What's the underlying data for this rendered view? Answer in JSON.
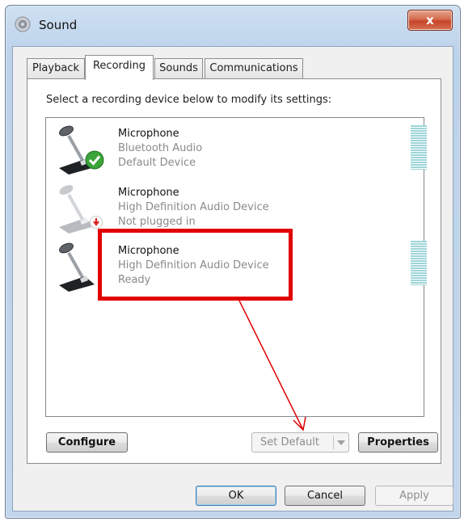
{
  "window": {
    "title": "Sound",
    "title_icon": "speaker-icon",
    "close_label": "x"
  },
  "tabs": [
    {
      "label": "Playback",
      "active": false
    },
    {
      "label": "Recording",
      "active": true
    },
    {
      "label": "Sounds",
      "active": false
    },
    {
      "label": "Communications",
      "active": false
    }
  ],
  "recording": {
    "instruction": "Select a recording device below to modify its settings:",
    "devices": [
      {
        "name": "Microphone",
        "description": "Bluetooth Audio",
        "status": "Default Device",
        "icon": "microphone-icon",
        "badge": "check-badge-icon",
        "selected": false
      },
      {
        "name": "Microphone",
        "description": "High Definition Audio Device",
        "status": "Not plugged in",
        "icon": "microphone-icon",
        "badge": "unplugged-badge-icon",
        "selected": false
      },
      {
        "name": "Microphone",
        "description": "High Definition Audio Device",
        "status": "Ready",
        "icon": "microphone-icon",
        "badge": "",
        "selected": false
      }
    ],
    "buttons": {
      "configure": "Configure",
      "set_default": "Set Default",
      "properties": "Properties"
    }
  },
  "footer": {
    "ok": "OK",
    "cancel": "Cancel",
    "apply": "Apply"
  },
  "colors": {
    "highlight": "#e10000",
    "level_meter": "#9fd5d8",
    "check_badge": "#3aa53a"
  }
}
